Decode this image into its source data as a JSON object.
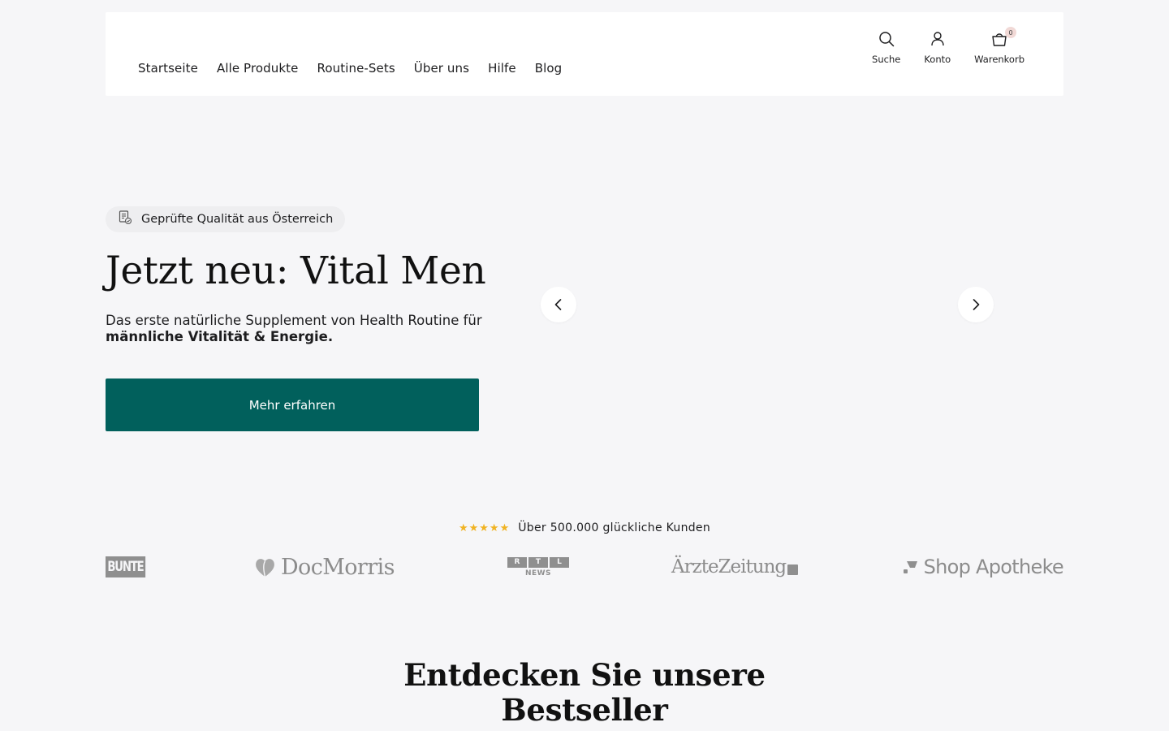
{
  "nav": {
    "items": [
      "Startseite",
      "Alle Produkte",
      "Routine-Sets",
      "Über uns",
      "Hilfe",
      "Blog"
    ]
  },
  "tools": {
    "search_label": "Suche",
    "account_label": "Konto",
    "cart_label": "Warenkorb",
    "cart_count": "0"
  },
  "hero": {
    "badge": "Geprüfte Qualität aus Österreich",
    "title": "Jetzt neu: Vital Men",
    "subtitle_prefix": "Das erste natürliche Supplement von Health Routine für ",
    "subtitle_bold": "männliche Vitalität & Energie.",
    "cta_label": "Mehr erfahren"
  },
  "trust": {
    "stars": "★★★★★",
    "rating_text": "Über 500.000 glückliche Kunden",
    "logos": {
      "bunte": "BUNTE",
      "docmorris": "DocMorris",
      "rtl_letters": [
        "R",
        "T",
        "L"
      ],
      "rtl_news": "NEWS",
      "aerzte": "ÄrzteZeitung",
      "shop": "Shop Apotheke"
    }
  },
  "bestseller": {
    "title_line1": "Entdecken Sie unsere",
    "title_line2": "Bestseller"
  },
  "colors": {
    "accent": "#01605c",
    "star": "#f0b323",
    "background": "#f6f6f8"
  }
}
